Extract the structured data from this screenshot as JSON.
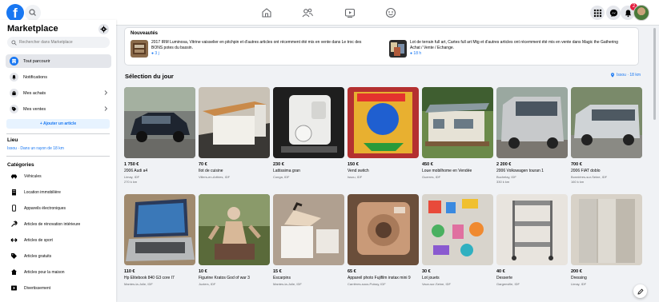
{
  "topbar": {
    "logo_letter": "f",
    "nav_icons": [
      "home-icon",
      "friends-icon",
      "watch-icon",
      "groups-icon"
    ],
    "right_icons": [
      "menu-grid-icon",
      "messenger-icon",
      "notifications-icon"
    ],
    "notification_count": "2"
  },
  "sidebar": {
    "title": "Marketplace",
    "search_placeholder": "Rechercher dans Marketplace",
    "nav": [
      {
        "label": "Tout parcourir",
        "icon": "storefront-icon",
        "active": true
      },
      {
        "label": "Notifications",
        "icon": "bell-icon"
      },
      {
        "label": "Mes achats",
        "icon": "bag-icon"
      },
      {
        "label": "Mes ventes",
        "icon": "tag-icon"
      }
    ],
    "add_button": "+ Ajouter un article",
    "location_heading": "Lieu",
    "location_value": "Issou · Dans un rayon de 18 km",
    "categories_heading": "Catégories",
    "categories": [
      {
        "label": "Véhicules",
        "icon": "car-icon"
      },
      {
        "label": "Location immobilière",
        "icon": "building-icon"
      },
      {
        "label": "Appareils électroniques",
        "icon": "phone-icon"
      },
      {
        "label": "Articles de rénovation intérieure",
        "icon": "tools-icon"
      },
      {
        "label": "Articles de sport",
        "icon": "dumbbell-icon"
      },
      {
        "label": "Articles gratuits",
        "icon": "gift-tag-icon"
      },
      {
        "label": "Articles pour la maison",
        "icon": "house-icon"
      },
      {
        "label": "Divertissement",
        "icon": "film-icon"
      }
    ]
  },
  "news": {
    "title": "Nouveautés",
    "items": [
      {
        "text": "2017 IRM Luminosa, Vitrine vaisselier en pitchpin et d'autres articles ont récemment été mis en vente dans Le troc des BONS potes du bassin.",
        "count": "● 3 j"
      },
      {
        "text": "Lot de terrain full art, Cartes full art Mtg et d'autres articles ont récemment été mis en vente dans Magic the Gathering Achat / Vente / Echange.",
        "count": "● 18 h"
      }
    ]
  },
  "main": {
    "section_title": "Sélection du jour",
    "location_link": "Issou · 18 km"
  },
  "listings": [
    {
      "price": "1 750 €",
      "title": "2006 Audi a4",
      "location": "Limay, IDF",
      "km": "270 k km",
      "image": "dark-sedan"
    },
    {
      "price": "70 €",
      "title": "Îlot de cuisine",
      "location": "Villers-en-Arthies, IDF",
      "km": "",
      "image": "kitchen-island"
    },
    {
      "price": "230 €",
      "title": "Lattissima gran",
      "location": "Conga, IDF",
      "km": "",
      "image": "coffee-machine"
    },
    {
      "price": "150 €",
      "title": "Vend switch",
      "location": "Issou, IDF",
      "km": "",
      "image": "sonic-game-box"
    },
    {
      "price": "450 €",
      "title": "Loue mobilhome en Vendée",
      "location": "Guerres, IDF",
      "km": "",
      "image": "mobile-home"
    },
    {
      "price": "2 200 €",
      "title": "2006 Volkswagen touran 1",
      "location": "Buchelay, IDF",
      "km": "330 k km",
      "image": "silver-minivan"
    },
    {
      "price": "700 €",
      "title": "2006 FIAT doblo",
      "location": "Bonnières-sur-Seine, IDF",
      "km": "160 k km",
      "image": "silver-van"
    },
    {
      "price": "110 €",
      "title": "Hp Elitebook 840 G3 core I7",
      "location": "Mantes-la-Jolie, IDF",
      "km": "",
      "image": "laptop"
    },
    {
      "price": "10 €",
      "title": "Figurine Kratos God of war 3",
      "location": "Juziers, IDF",
      "km": "",
      "image": "figurine"
    },
    {
      "price": "15 €",
      "title": "Escarpins",
      "location": "Mantes-la-Jolie, IDF",
      "km": "",
      "image": "shoes"
    },
    {
      "price": "65 €",
      "title": "Appareil photo Fujifilm instax mini 9",
      "location": "Carrières-sous-Poissy, IDF",
      "km": "",
      "image": "instax-case"
    },
    {
      "price": "30 €",
      "title": "Lot jouets",
      "location": "Vaux-sur-Seine, IDF",
      "km": "",
      "image": "toys"
    },
    {
      "price": "40 €",
      "title": "Desserte",
      "location": "Gargenville, IDF",
      "km": "",
      "image": "serving-cart"
    },
    {
      "price": "200 €",
      "title": "Dressing",
      "location": "Limay, IDF",
      "km": "",
      "image": "wardrobe"
    }
  ],
  "colors": {
    "brand": "#1877f2",
    "background": "#f0f2f5",
    "badge": "#e41e3f"
  }
}
